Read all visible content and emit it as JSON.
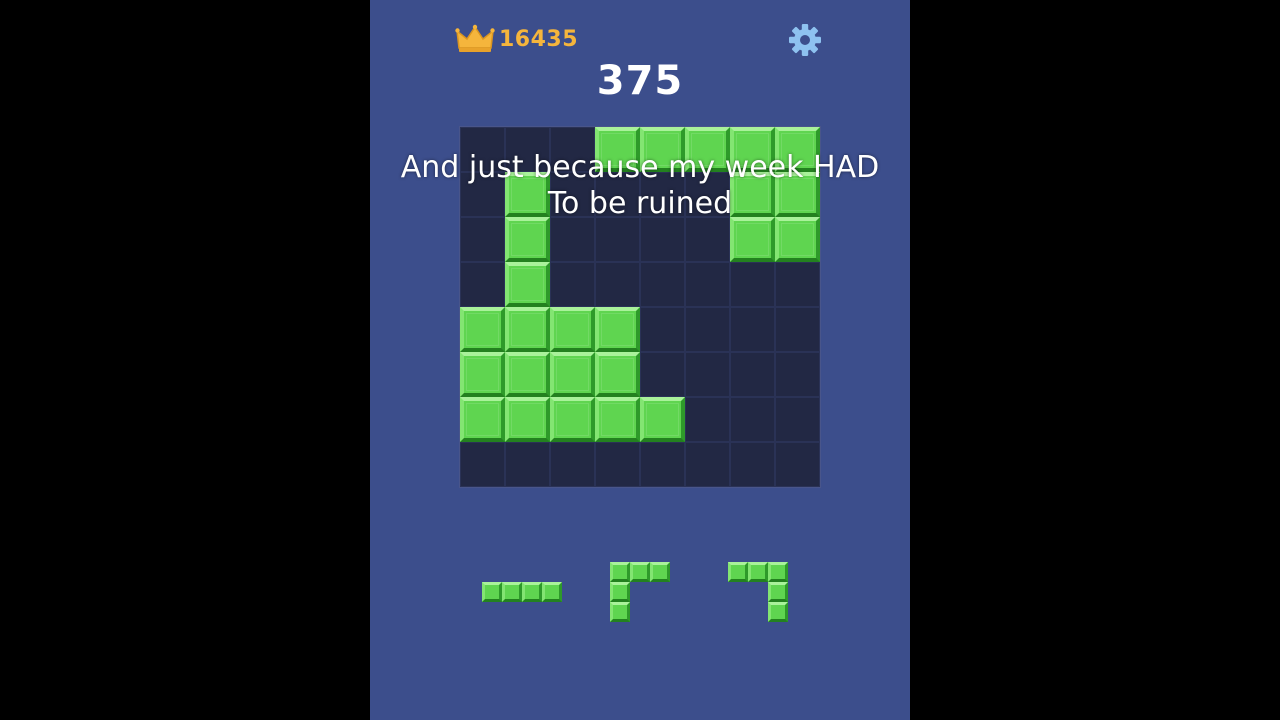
{
  "header": {
    "best_score": "16435",
    "current_score": "375"
  },
  "caption": {
    "line1": "And just because my week HAD",
    "line2": "To be ruined"
  },
  "icons": {
    "best": "crown-icon",
    "settings": "gear-icon"
  },
  "colors": {
    "background": "#3c4e8c",
    "board": "#222844",
    "block": "#5fd550",
    "best_score": "#f5b53c",
    "letterbox": "#000000"
  },
  "board": {
    "cols": 8,
    "rows": 8,
    "filled": [
      [
        0,
        3
      ],
      [
        0,
        4
      ],
      [
        0,
        5
      ],
      [
        0,
        6
      ],
      [
        0,
        7
      ],
      [
        1,
        1
      ],
      [
        1,
        6
      ],
      [
        1,
        7
      ],
      [
        2,
        1
      ],
      [
        2,
        6
      ],
      [
        2,
        7
      ],
      [
        3,
        1
      ],
      [
        4,
        0
      ],
      [
        4,
        1
      ],
      [
        4,
        2
      ],
      [
        4,
        3
      ],
      [
        5,
        0
      ],
      [
        5,
        1
      ],
      [
        5,
        2
      ],
      [
        5,
        3
      ],
      [
        6,
        0
      ],
      [
        6,
        1
      ],
      [
        6,
        2
      ],
      [
        6,
        3
      ],
      [
        6,
        4
      ]
    ]
  },
  "tray": {
    "pieces": [
      {
        "name": "piece-i4-horizontal",
        "cells": [
          [
            0,
            0
          ],
          [
            0,
            1
          ],
          [
            0,
            2
          ],
          [
            0,
            3
          ]
        ]
      },
      {
        "name": "piece-corner-left",
        "cells": [
          [
            0,
            0
          ],
          [
            0,
            1
          ],
          [
            0,
            2
          ],
          [
            1,
            0
          ],
          [
            2,
            0
          ]
        ]
      },
      {
        "name": "piece-corner-right",
        "cells": [
          [
            0,
            0
          ],
          [
            0,
            1
          ],
          [
            0,
            2
          ],
          [
            1,
            2
          ],
          [
            2,
            2
          ]
        ]
      }
    ]
  }
}
